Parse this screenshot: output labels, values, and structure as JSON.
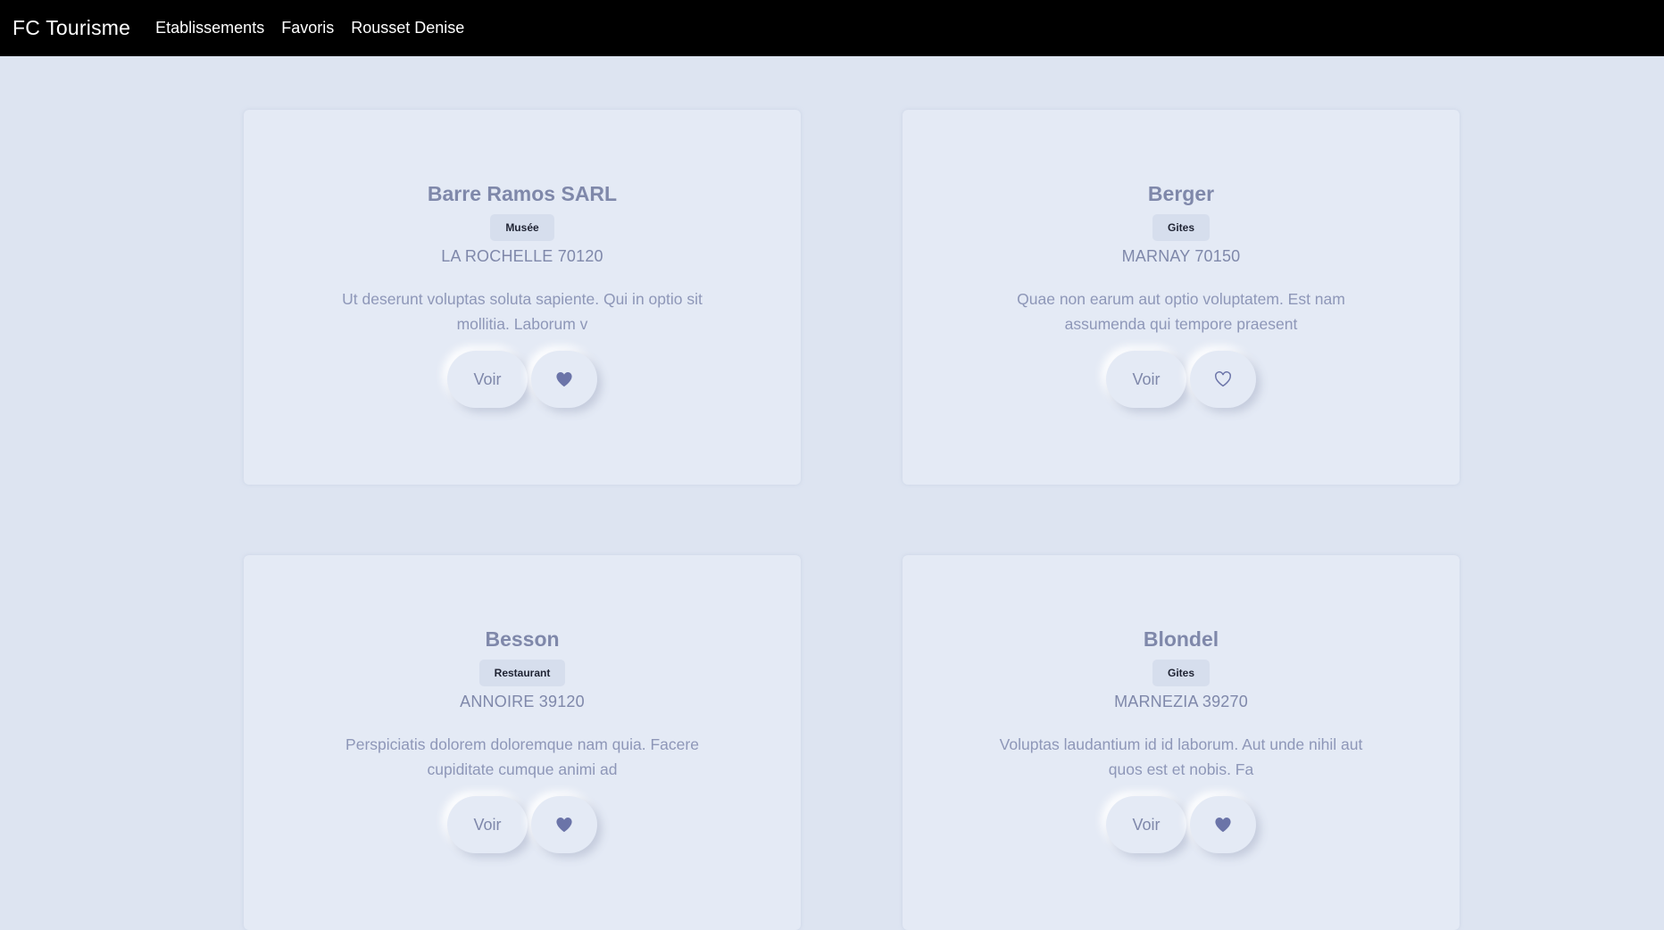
{
  "navbar": {
    "brand": "FC Tourisme",
    "links": [
      "Etablissements",
      "Favoris",
      "Rousset Denise"
    ]
  },
  "cards": [
    {
      "name": "Barre Ramos SARL",
      "category": "Musée",
      "address": "LA ROCHELLE 70120",
      "description": "Ut deserunt voluptas soluta sapiente. Qui in optio sit mollitia. Laborum v",
      "view_label": "Voir",
      "favorite": true,
      "favorite_icon": "heart-filled-icon"
    },
    {
      "name": "Berger",
      "category": "Gites",
      "address": "MARNAY 70150",
      "description": "Quae non earum aut optio voluptatem. Est nam assumenda qui tempore praesent",
      "view_label": "Voir",
      "favorite": false,
      "favorite_icon": "heart-outline-icon"
    },
    {
      "name": "Besson",
      "category": "Restaurant",
      "address": "ANNOIRE 39120",
      "description": "Perspiciatis dolorem doloremque nam quia. Facere cupiditate cumque animi ad",
      "view_label": "Voir",
      "favorite": true,
      "favorite_icon": "heart-filled-icon"
    },
    {
      "name": "Blondel",
      "category": "Gites",
      "address": "MARNEZIA 39270",
      "description": "Voluptas laudantium id id laborum. Aut unde nihil aut quos est et nobis. Fa",
      "view_label": "Voir",
      "favorite": true,
      "favorite_icon": "heart-filled-icon"
    }
  ],
  "colors": {
    "navbar_bg": "#000000",
    "page_bg": "#dde4f1",
    "card_bg": "#e4eaf5",
    "text_muted": "#7f88aa",
    "heart": "#6b74a8"
  }
}
